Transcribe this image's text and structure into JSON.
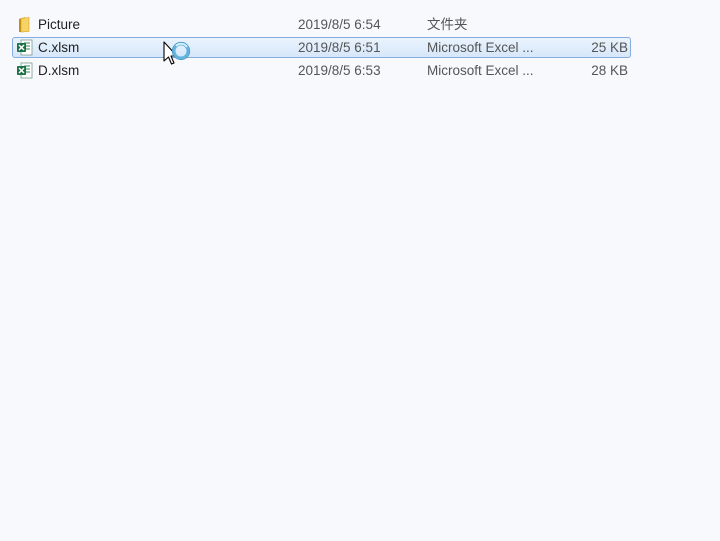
{
  "files": [
    {
      "name": "Picture",
      "date": "2019/8/5 6:54",
      "type": "文件夹",
      "size": "",
      "icon": "folder-icon",
      "selected": false
    },
    {
      "name": "C.xlsm",
      "date": "2019/8/5 6:51",
      "type": "Microsoft Excel ...",
      "size": "25 KB",
      "icon": "excel-file-icon",
      "selected": true
    },
    {
      "name": "D.xlsm",
      "date": "2019/8/5 6:53",
      "type": "Microsoft Excel ...",
      "size": "28 KB",
      "icon": "excel-file-icon",
      "selected": false
    }
  ],
  "cursor": {
    "icon": "busy-cursor-icon"
  },
  "colors": {
    "background": "#f7f9fc",
    "selection_border": "#84acdd",
    "selection_fill": "#d7e7fa",
    "folder": "#f0c14b",
    "excel_green": "#1e7145"
  }
}
